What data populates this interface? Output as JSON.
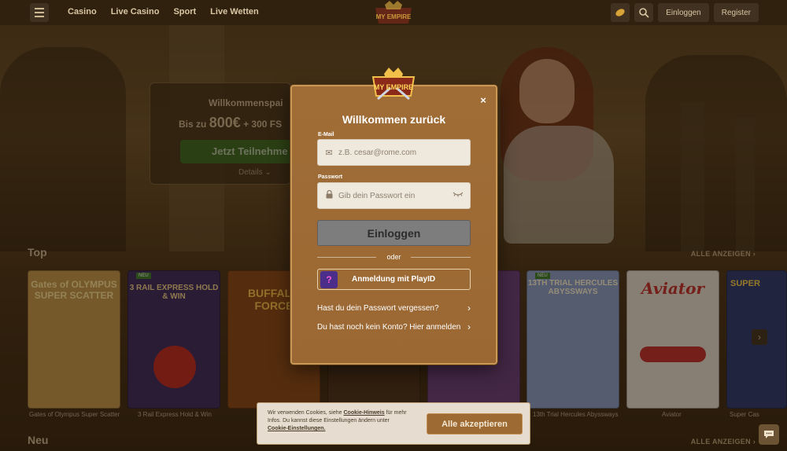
{
  "nav": {
    "links": [
      "Casino",
      "Live Casino",
      "Sport",
      "Live Wetten"
    ],
    "login_label": "Einloggen",
    "register_label": "Register",
    "logo_text": "MY EMPIRE"
  },
  "promo": {
    "line1": "Willkommenspai",
    "line2_prefix": "Bis zu",
    "line2_amount": "800€",
    "line2_suffix": "+ 300 FS",
    "cta": "Jetzt Teilnehme",
    "details": "Details"
  },
  "sections": {
    "top_title": "Top",
    "new_title": "Neu",
    "see_all": "ALLE ANZEIGEN"
  },
  "games": [
    {
      "name": "Gates of Olympus Super Scatter",
      "art": "Gates of OLYMPUS SUPER SCATTER",
      "bg": "#c79a4a"
    },
    {
      "name": "3 Rail Express Hold & Win",
      "art": "3 RAIL EXPRESS HOLD & WIN",
      "bg": "#3c2a5e",
      "badge": "NEU"
    },
    {
      "name": "",
      "art": "BUFFALO FORCE",
      "bg": "#8a4a16"
    },
    {
      "name": "",
      "art": "",
      "bg": "#4a3018"
    },
    {
      "name": "",
      "art": "",
      "bg": "#6a3e7a"
    },
    {
      "name": "13th Trial Hercules Abyssways",
      "art": "13TH TRIAL HERCULES ABYSSWAYS",
      "bg": "#8a9ec8",
      "badge": "NEU"
    },
    {
      "name": "Aviator",
      "art": "Aviator",
      "bg": "#e6ddd0"
    },
    {
      "name": "Super Cas",
      "art": "SUPER",
      "bg": "#2c3a70"
    }
  ],
  "modal": {
    "title": "Willkommen zurück",
    "email_label": "E-Mail",
    "email_placeholder": "z.B. cesar@rome.com",
    "password_label": "Passwort",
    "password_placeholder": "Gib dein Passwort ein",
    "login_button": "Einloggen",
    "or": "oder",
    "playid_label": "Anmeldung mit PlayID",
    "forgot_password": "Hast du dein Passwort vergessen?",
    "register_link": "Du hast noch kein Konto? Hier anmelden",
    "close": "×"
  },
  "cookie": {
    "text_1": "Wir verwenden Cookies, siehe ",
    "link_hinweis": "Cookie-Hinweis",
    "text_2": " für mehr Infos. Du kannst diese Einstellungen ändern unter ",
    "link_settings": "Cookie-Einstellungen.",
    "accept": "Alle akzeptieren"
  }
}
